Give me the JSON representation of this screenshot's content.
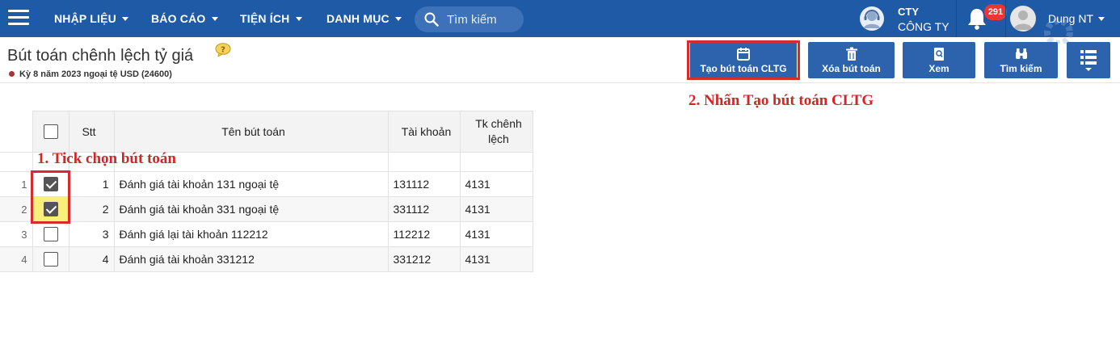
{
  "topbar": {
    "menu": [
      {
        "label": "NHẬP LIỆU"
      },
      {
        "label": "BÁO CÁO"
      },
      {
        "label": "TIỆN ÍCH"
      },
      {
        "label": "DANH MỤC"
      }
    ],
    "search_placeholder": "Tìm kiếm",
    "company_line1": "CTY",
    "company_line2": "CÔNG TY",
    "notification_count": "291",
    "user_name": "Dung NT",
    "brand_color": "#1f5aa6"
  },
  "page": {
    "title": "Bút toán chênh lệch tỷ giá",
    "period": "Kỳ 8 năm 2023 ngoại tệ USD (24600)"
  },
  "toolbar": {
    "create_label": "Tạo bút toán CLTG",
    "delete_label": "Xóa bút toán",
    "view_label": "Xem",
    "search_label": "Tìm kiếm"
  },
  "annotations": {
    "step1": "1. Tick chọn bút toán",
    "step2": "2. Nhấn Tạo bút toán CLTG",
    "color": "#d32525"
  },
  "table": {
    "headers": {
      "stt": "Stt",
      "name": "Tên bút toán",
      "account": "Tài khoản",
      "diff_account": "Tk chênh lệch"
    },
    "rows": [
      {
        "rownum": "1",
        "checked": true,
        "stt": "1",
        "name": "Đánh giá tài khoản 131 ngoại tệ",
        "account": "131112",
        "diff": "4131"
      },
      {
        "rownum": "2",
        "checked": true,
        "stt": "2",
        "name": "Đánh giá tài khoản 331 ngoại tệ",
        "account": "331112",
        "diff": "4131"
      },
      {
        "rownum": "3",
        "checked": false,
        "stt": "3",
        "name": "Đánh giá lại tài khoản 112212",
        "account": "112212",
        "diff": "4131"
      },
      {
        "rownum": "4",
        "checked": false,
        "stt": "4",
        "name": "Đánh giá tài khoản 331212",
        "account": "331212",
        "diff": "4131"
      }
    ]
  }
}
